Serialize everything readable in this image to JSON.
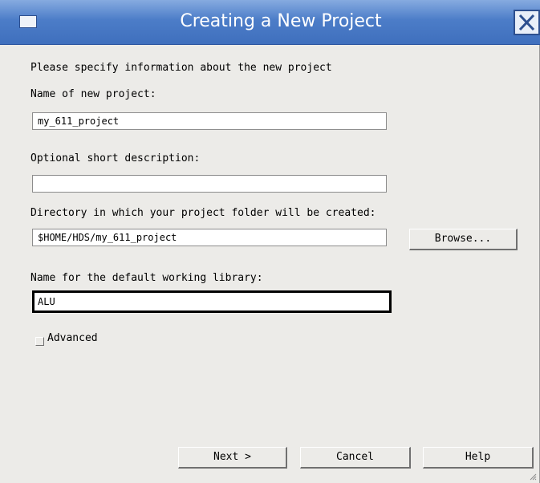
{
  "window": {
    "title": "Creating a New Project"
  },
  "form": {
    "intro": "Please specify information about the new project",
    "project_name": {
      "label": "Name of new project:",
      "value": "my_611_project"
    },
    "description": {
      "label": "Optional short description:",
      "value": ""
    },
    "directory": {
      "label": "Directory in which your project folder will be created:",
      "value": "$HOME/HDS/my_611_project"
    },
    "library": {
      "label": "Name for the default working library:",
      "value": "ALU"
    },
    "advanced": {
      "label": "Advanced",
      "checked": false
    },
    "browse_label": "Browse..."
  },
  "footer": {
    "next_label": "Next >",
    "cancel_label": "Cancel",
    "help_label": "Help"
  },
  "icons": [
    "window-menu-icon",
    "close-icon",
    "resize-grip-icon"
  ],
  "colors": {
    "titlebar": "#4c7dc8",
    "dialog_bg": "#ecebe8"
  }
}
